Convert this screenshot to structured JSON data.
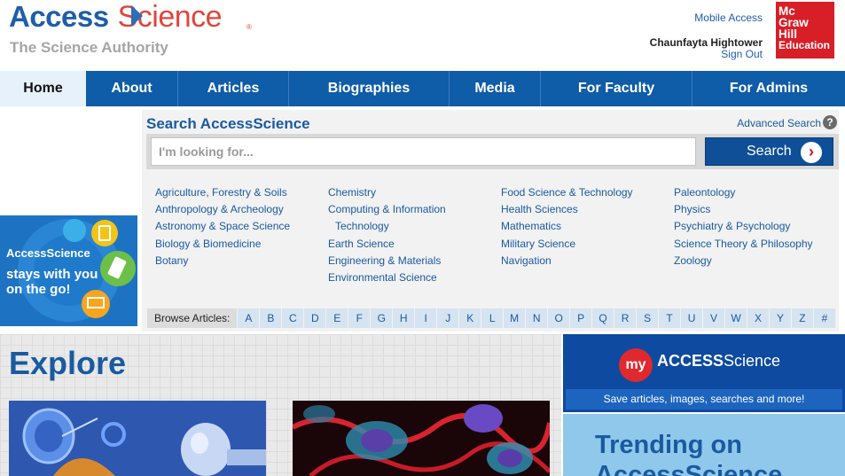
{
  "header": {
    "logo_access": "Access",
    "logo_science": "Science",
    "logo_registered": "®",
    "tagline": "The Science Authority",
    "mobile_access": "Mobile Access",
    "user_name": "Chaunfayta Hightower",
    "sign_out": "Sign Out",
    "publisher_logo_lines": [
      "Mc",
      "Graw",
      "Hill",
      "Education"
    ]
  },
  "nav": {
    "items": [
      {
        "label": "Home",
        "active": true
      },
      {
        "label": "About"
      },
      {
        "label": "Articles"
      },
      {
        "label": "Biographies"
      },
      {
        "label": "Media"
      },
      {
        "label": "For Faculty"
      },
      {
        "label": "For Admins"
      }
    ]
  },
  "promo": {
    "line1": "AccessScience",
    "line2": "stays with you",
    "line3": "on the go!"
  },
  "search": {
    "title": "Search AccessScience",
    "advanced": "Advanced Search",
    "help_icon": "?",
    "placeholder": "I'm looking for...",
    "button_label": "Search",
    "button_icon": "›"
  },
  "subjects": {
    "col1": [
      "Agriculture, Forestry & Soils",
      "Anthropology & Archeology",
      "Astronomy & Space Science",
      "Biology & Biomedicine",
      "Botany"
    ],
    "col2": [
      "Chemistry",
      "Computing & Information",
      "Technology",
      "Earth Science",
      "Engineering & Materials",
      "Environmental Science"
    ],
    "col3": [
      "Food Science & Technology",
      "Health Sciences",
      "Mathematics",
      "Military Science",
      "Navigation"
    ],
    "col4": [
      "Paleontology",
      "Physics",
      "Psychiatry & Psychology",
      "Science Theory & Philosophy",
      "Zoology"
    ]
  },
  "browse": {
    "label": "Browse Articles:",
    "letters": [
      "A",
      "B",
      "C",
      "D",
      "E",
      "F",
      "G",
      "H",
      "I",
      "J",
      "K",
      "L",
      "M",
      "N",
      "O",
      "P",
      "Q",
      "R",
      "S",
      "T",
      "U",
      "V",
      "W",
      "X",
      "Y",
      "Z",
      "#"
    ]
  },
  "explore": {
    "title": "Explore"
  },
  "my_access": {
    "badge": "my",
    "logo_access": "ACCESS",
    "logo_science": "Science",
    "tagline": "Save articles, images, searches and more!"
  },
  "trending": {
    "title_line1": "Trending on",
    "title_line2": "AccessScience"
  },
  "colors": {
    "brand_blue": "#0f5ca8",
    "brand_red": "#e0463a",
    "publisher_red": "#d81e26"
  }
}
